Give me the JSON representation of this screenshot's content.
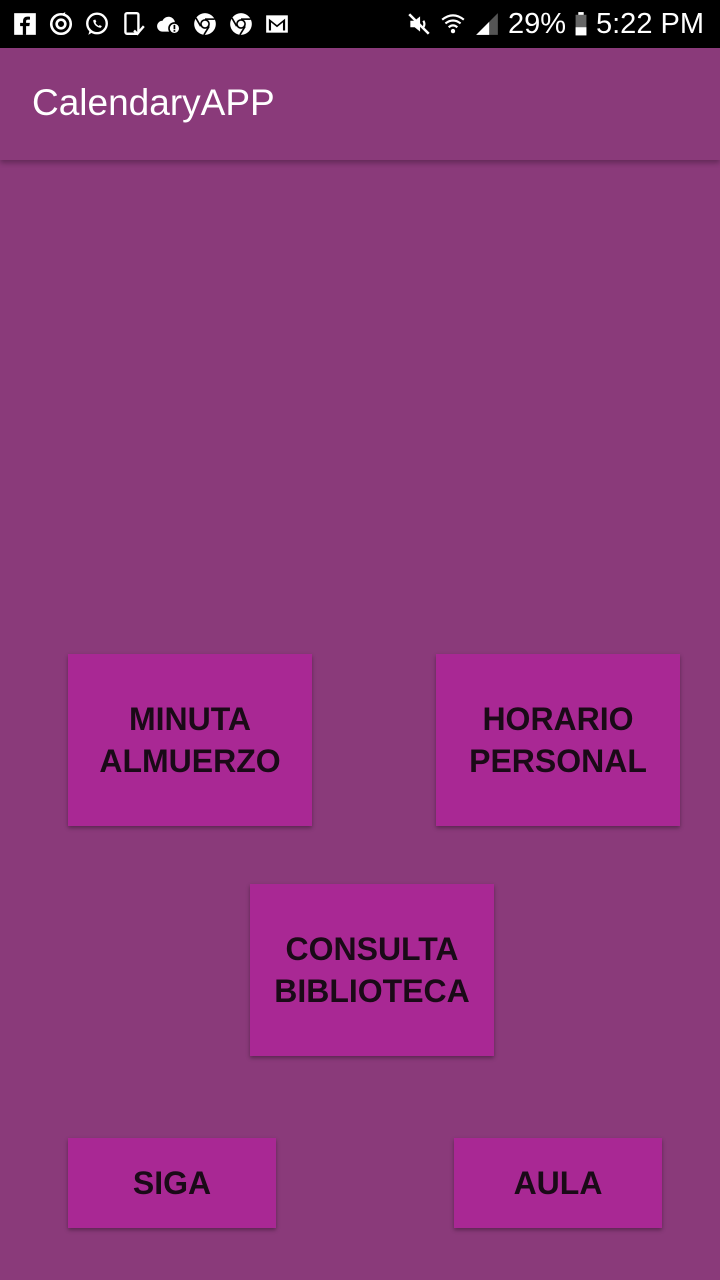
{
  "status_bar": {
    "left_icons": [
      "facebook-icon",
      "sync-icon",
      "whatsapp-icon",
      "phone-check-icon",
      "cloud-alert-icon",
      "chrome-icon",
      "chrome-icon",
      "gmail-icon"
    ],
    "battery_percent": "29%",
    "time": "5:22 PM"
  },
  "app_bar": {
    "title": "CalendaryAPP"
  },
  "buttons": {
    "minuta": "MINUTA\nALMUERZO",
    "horario": "HORARIO\nPERSONAL",
    "consulta": "CONSULTA\nBIBLIOTECA",
    "siga": "SIGA",
    "aula": "AULA"
  },
  "colors": {
    "background": "#8a3a7a",
    "button": "#a92894",
    "status_bar": "#000000"
  }
}
